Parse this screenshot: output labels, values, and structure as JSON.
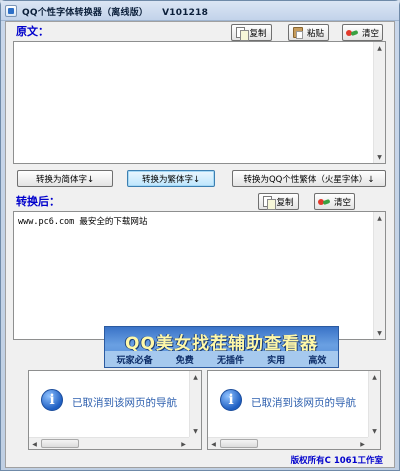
{
  "window": {
    "title": "QQ个性字体转换器（离线版）",
    "version": "V101218"
  },
  "source": {
    "label": "原文：",
    "text": "",
    "copy_label": "复制",
    "paste_label": "粘贴",
    "clear_label": "清空"
  },
  "convert": {
    "to_simplified": "转换为简体字↓",
    "to_traditional": "转换为繁体字↓",
    "to_qq_traditional": "转换为QQ个性繁体（火星字体）↓"
  },
  "result": {
    "label": "转换后：",
    "text": "www.pc6.com 最安全的下载网站",
    "copy_label": "复制",
    "clear_label": "清空"
  },
  "banner": {
    "title": "QQ美女找茬辅助查看器",
    "tags": [
      "玩家必备",
      "免费",
      "无插件",
      "实用",
      "高效"
    ]
  },
  "web_panes": {
    "left_message": "已取消到该网页的导航",
    "right_message": "已取消到该网页的导航"
  },
  "footer": {
    "copyright": "版权所有C 1061工作室"
  },
  "icons": [
    "app-icon",
    "copy-icon",
    "paste-icon",
    "clear-icon",
    "info-icon"
  ],
  "colors": {
    "label_blue": "#0000cc",
    "banner_yellow": "#fff8a8",
    "banner_blue": "#3a73c7"
  }
}
